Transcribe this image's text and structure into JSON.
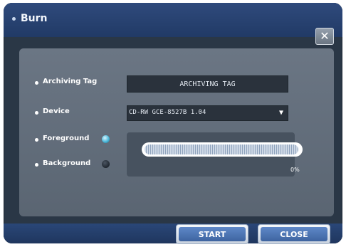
{
  "window": {
    "title": "Burn",
    "close_icon": "close-icon"
  },
  "form": {
    "archiving_tag_label": "Archiving Tag",
    "archiving_tag_value": "ARCHIVING TAG",
    "device_label": "Device",
    "device_value": "CD-RW GCE-8527B 1.04",
    "device_arrow_icon": "dropdown-arrow-icon",
    "foreground_label": "Foreground",
    "background_label": "Background",
    "foreground_selected": true,
    "background_selected": false
  },
  "progress": {
    "percent_text": "0%",
    "value": 0
  },
  "buttons": {
    "start": "START",
    "close": "CLOSE"
  },
  "colors": {
    "accent": "#4db7d9",
    "titlebar": "#2f4a7c",
    "panel": "#6b7684",
    "button": "#4f78b8"
  }
}
